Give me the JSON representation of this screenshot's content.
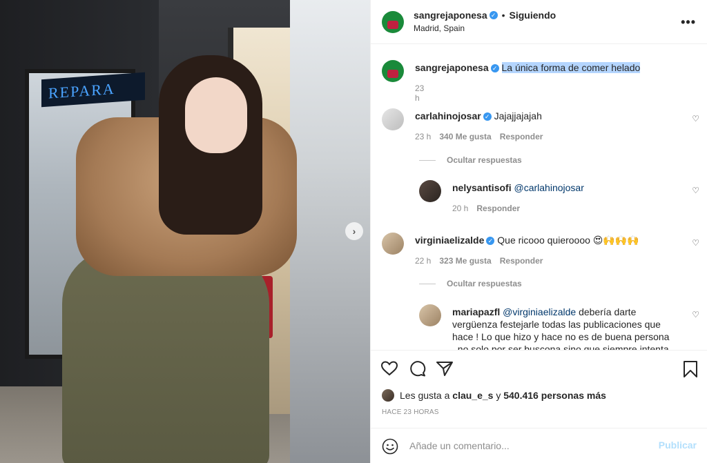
{
  "post": {
    "photo_sign_text": "REPARA",
    "carousel_next": "›"
  },
  "header": {
    "username": "sangrejaponesa",
    "separator": "•",
    "follow_status": "Siguiendo",
    "location": "Madrid, Spain",
    "more": "•••"
  },
  "caption": {
    "username": "sangrejaponesa",
    "text": "La única forma de comer helado",
    "time": "23 h"
  },
  "comments": [
    {
      "username": "carlahinojosar",
      "verified": true,
      "text": "Jajajjajajah",
      "time": "23 h",
      "likes": "340 Me gusta",
      "reply": "Responder",
      "hide_replies": "Ocultar respuestas"
    },
    {
      "username": "nelysantisofi",
      "mention": "@carlahinojosar",
      "time": "20 h",
      "reply": "Responder"
    },
    {
      "username": "virginiaelizalde",
      "verified": true,
      "text": "Que ricooo quieroooo 😍🙌🙌🙌",
      "time": "22 h",
      "likes": "323 Me gusta",
      "reply": "Responder",
      "hide_replies": "Ocultar respuestas"
    },
    {
      "username": "mariapazfl",
      "mention": "@virginiaelizalde",
      "text": " debería darte vergüenza festejarle todas las publicaciones que hace ! Lo que hizo y hace no es de buena persona , no solo por ser buscona sino que siempre intenta"
    }
  ],
  "actions": {
    "likes_prefix": "Les gusta a ",
    "likes_user": "clau_e_s",
    "likes_and": " y ",
    "likes_count": "540.416 personas más",
    "time_ago": "HACE 23 HORAS"
  },
  "add_comment": {
    "placeholder": "Añade un comentario...",
    "post_label": "Publicar"
  },
  "colors": {
    "verified": "#3897f0",
    "highlight": "#b4d5fe",
    "post_disabled": "#b2dffc"
  }
}
